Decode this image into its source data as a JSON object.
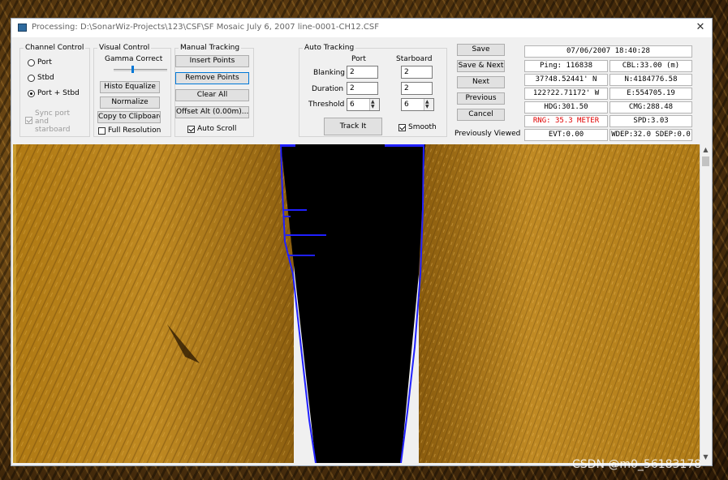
{
  "window": {
    "title": "Processing: D:\\SonarWiz-Projects\\123\\CSF\\SF Mosaic July 6, 2007 line-0001-CH12.CSF",
    "close_glyph": "✕"
  },
  "channel_control": {
    "legend": "Channel Control",
    "options": [
      "Port",
      "Stbd",
      "Port + Stbd"
    ],
    "selected": "Port + Stbd",
    "sync_label_1": "Sync port",
    "sync_label_2": "and",
    "sync_label_3": "starboard",
    "sync_checked": true
  },
  "visual_control": {
    "legend": "Visual Control",
    "gamma_label": "Gamma Correct",
    "histo_equalize": "Histo Equalize",
    "normalize": "Normalize",
    "copy_clipboard": "Copy to Clipboard",
    "full_resolution": "Full Resolution",
    "full_resolution_checked": false
  },
  "manual_tracking": {
    "legend": "Manual Tracking",
    "insert_points": "Insert Points",
    "remove_points": "Remove Points",
    "clear_all": "Clear All",
    "offset_alt": "Offset Alt (0.00m)...",
    "auto_scroll": "Auto Scroll",
    "auto_scroll_checked": true
  },
  "auto_tracking": {
    "legend": "Auto Tracking",
    "col_port": "Port",
    "col_starboard": "Starboard",
    "blanking_label": "Blanking",
    "duration_label": "Duration",
    "threshold_label": "Threshold",
    "blanking_port": "2",
    "blanking_stbd": "2",
    "duration_port": "2",
    "duration_stbd": "2",
    "threshold_port": "6",
    "threshold_stbd": "6",
    "track_it": "Track It",
    "smooth": "Smooth",
    "smooth_checked": true
  },
  "nav_buttons": {
    "save": "Save",
    "save_next": "Save & Next",
    "next": "Next",
    "previous": "Previous",
    "cancel": "Cancel",
    "previously_viewed": "Previously Viewed"
  },
  "info": {
    "datetime": "07/06/2007 18:40:28",
    "ping": "Ping: 116838",
    "cbl": "CBL:33.00 (m)",
    "lat": "37?48.52441' N",
    "north": "N:4184776.58",
    "lon": "122?22.71172' W",
    "east": "E:554705.19",
    "hdg": "HDG:301.50",
    "cmg": "CMG:288.48",
    "rng": "RNG: 35.3 METER",
    "spd": "SPD:3.03",
    "evt": "EVT:0.00",
    "wdep": "WDEP:32.0 SDEP:0.0"
  },
  "colors": {
    "sonar_gold": "#b8861f",
    "water_column": "#000000",
    "bottom_track": "#2020ff",
    "rng_red": "#e00000"
  },
  "watermark": "CSDN @m0_56183178"
}
